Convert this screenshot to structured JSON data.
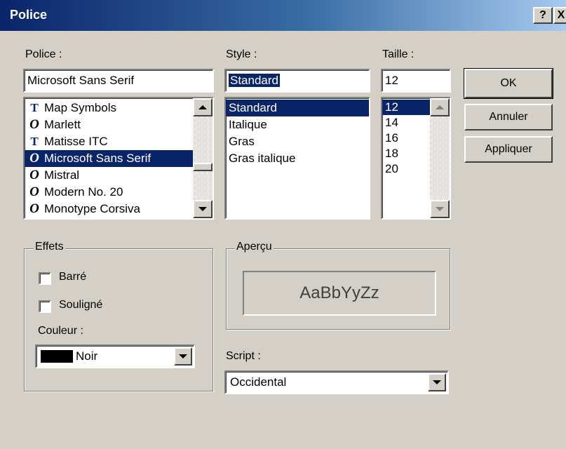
{
  "window": {
    "title": "Police",
    "help_label": "?",
    "close_label": "X"
  },
  "font": {
    "label": "Police :",
    "value": "Microsoft Sans Serif",
    "items": [
      {
        "name": "Map Symbols",
        "icon": "truetype-icon"
      },
      {
        "name": "Marlett",
        "icon": "opentype-icon"
      },
      {
        "name": "Matisse ITC",
        "icon": "truetype-icon"
      },
      {
        "name": "Microsoft Sans Serif",
        "icon": "opentype-icon"
      },
      {
        "name": "Mistral",
        "icon": "opentype-icon"
      },
      {
        "name": "Modern No. 20",
        "icon": "opentype-icon"
      },
      {
        "name": "Monotype Corsiva",
        "icon": "opentype-icon"
      }
    ],
    "selected": "Microsoft Sans Serif"
  },
  "style": {
    "label": "Style :",
    "value": "Standard",
    "items": [
      "Standard",
      "Italique",
      "Gras",
      "Gras italique"
    ],
    "selected": "Standard"
  },
  "size": {
    "label": "Taille :",
    "value": "12",
    "items": [
      "12",
      "14",
      "16",
      "18",
      "20"
    ],
    "selected": "12"
  },
  "buttons": {
    "ok": "OK",
    "cancel": "Annuler",
    "apply": "Appliquer"
  },
  "effects": {
    "legend": "Effets",
    "strikeout": "Barré",
    "underline": "Souligné",
    "color_label": "Couleur :",
    "color_value": "Noir",
    "color_swatch": "#000000"
  },
  "preview": {
    "legend": "Aperçu",
    "sample": "AaBbYyZz"
  },
  "script": {
    "label": "Script :",
    "value": "Occidental"
  },
  "colors": {
    "selection": "#0a246a",
    "face": "#d4d0c8"
  }
}
